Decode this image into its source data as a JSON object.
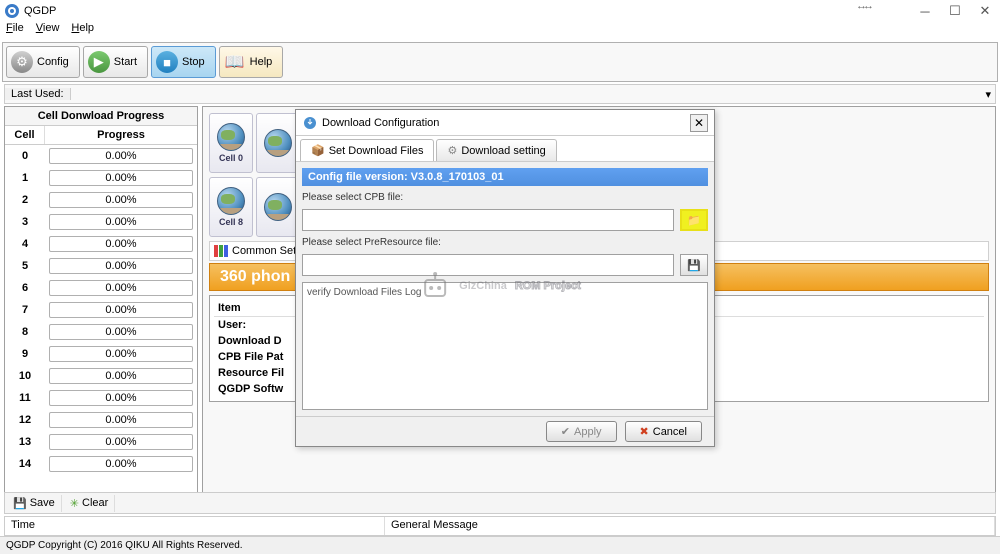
{
  "window": {
    "title": "QGDP"
  },
  "menubar": {
    "file": "File",
    "view": "View",
    "help": "Help"
  },
  "toolbar": {
    "config": "Config",
    "start": "Start",
    "stop": "Stop",
    "help": "Help"
  },
  "lastused": {
    "label": "Last Used:"
  },
  "progress": {
    "title": "Cell Donwload Progress",
    "h_cell": "Cell",
    "h_progress": "Progress",
    "rows": [
      {
        "cell": "0",
        "pct": "0.00%"
      },
      {
        "cell": "1",
        "pct": "0.00%"
      },
      {
        "cell": "2",
        "pct": "0.00%"
      },
      {
        "cell": "3",
        "pct": "0.00%"
      },
      {
        "cell": "4",
        "pct": "0.00%"
      },
      {
        "cell": "5",
        "pct": "0.00%"
      },
      {
        "cell": "6",
        "pct": "0.00%"
      },
      {
        "cell": "7",
        "pct": "0.00%"
      },
      {
        "cell": "8",
        "pct": "0.00%"
      },
      {
        "cell": "9",
        "pct": "0.00%"
      },
      {
        "cell": "10",
        "pct": "0.00%"
      },
      {
        "cell": "11",
        "pct": "0.00%"
      },
      {
        "cell": "12",
        "pct": "0.00%"
      },
      {
        "cell": "13",
        "pct": "0.00%"
      },
      {
        "cell": "14",
        "pct": "0.00%"
      }
    ]
  },
  "cells": {
    "c0": "Cell 0",
    "c8": "Cell 8"
  },
  "sections": {
    "common_setting": "Common Settin",
    "orange_bar": "360  phon"
  },
  "items": {
    "header": "Item",
    "user": "User:",
    "download": "Download D",
    "cpb": "CPB File Pat",
    "resource": "Resource Fil",
    "qgdp": "QGDP Softw"
  },
  "modal": {
    "title": "Download Configuration",
    "tab_set": "Set Download Files",
    "tab_setting": "Download setting",
    "config_version": "Config file version: V3.0.8_170103_01",
    "cpb_label": "Please select CPB file:",
    "pre_label": "Please select PreResource file:",
    "log_text": "verify Download Files Log",
    "apply": "Apply",
    "cancel": "Cancel"
  },
  "footer": {
    "save": "Save",
    "clear": "Clear",
    "time": "Time",
    "general_msg": "General Message",
    "copyright": "QGDP Copyright (C) 2016 QIKU All Rights Reserved."
  },
  "watermark": {
    "text_a": "GizChina",
    "text_b": "ROM Project"
  }
}
